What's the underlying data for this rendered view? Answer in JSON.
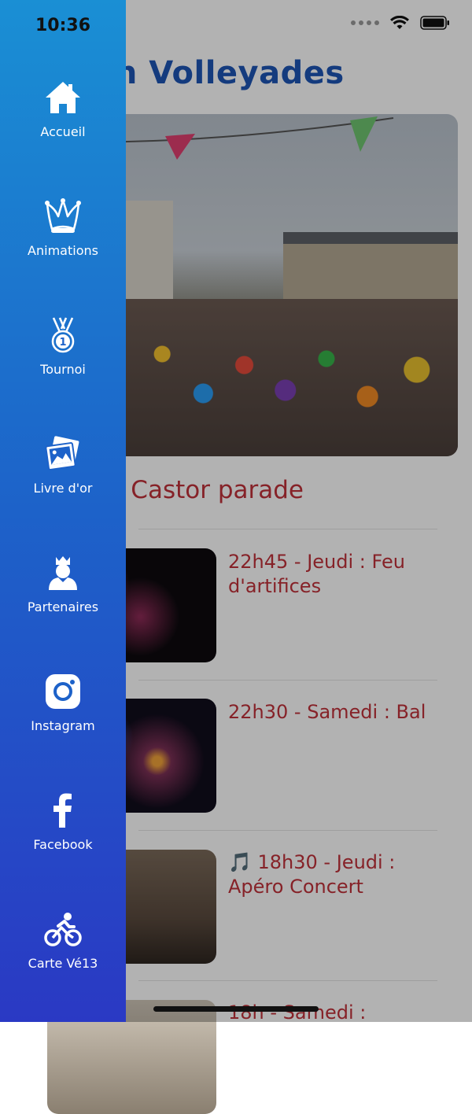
{
  "status_bar": {
    "time": "10:36"
  },
  "page": {
    "title": "reizh Volleyades",
    "featured_caption": "Jeudi : Castor parade",
    "events": [
      {
        "title": "22h45 - Jeudi : Feu d'artifices"
      },
      {
        "title": "22h30 - Samedi : Bal"
      },
      {
        "title": "🎵 18h30 - Jeudi : Apéro Concert"
      },
      {
        "title": "18h - Samedi :"
      }
    ]
  },
  "drawer": {
    "items": [
      {
        "label": "Accueil",
        "icon": "home-icon"
      },
      {
        "label": "Animations",
        "icon": "jester-hat-icon"
      },
      {
        "label": "Tournoi",
        "icon": "medal-icon"
      },
      {
        "label": "Livre d'or",
        "icon": "photos-icon"
      },
      {
        "label": "Partenaires",
        "icon": "king-icon"
      },
      {
        "label": "Instagram",
        "icon": "instagram-icon"
      },
      {
        "label": "Facebook",
        "icon": "facebook-icon"
      },
      {
        "label": "Carte Vé13",
        "icon": "cyclist-icon"
      }
    ]
  },
  "colors": {
    "drawer_top": "#1a8fd4",
    "drawer_bottom": "#2a39c4",
    "title_blue": "#1d55b5",
    "accent_red": "#c0313a"
  }
}
